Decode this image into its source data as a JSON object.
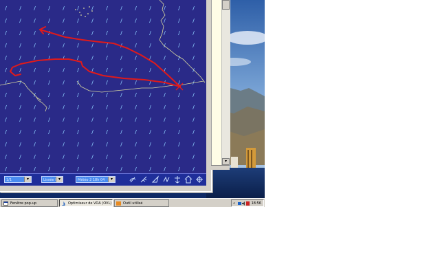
{
  "map": {
    "cells_label": "map-grid"
  },
  "statusbar": {
    "select1": "1/1",
    "select2": "Lissée 8",
    "select3": "Météo 2 18h 04"
  },
  "taskbar": {
    "items": [
      {
        "label": "Fenêtre pop-up"
      },
      {
        "label": "Optimiseur de VOA (OVL)"
      },
      {
        "label": "Outil utilisé"
      }
    ],
    "clock": "18:56"
  },
  "colors": {
    "map_bg": "#2a2a88",
    "route": "#e11a1a",
    "coast": "#d8d8a0",
    "wind": "#8fd0ff"
  }
}
